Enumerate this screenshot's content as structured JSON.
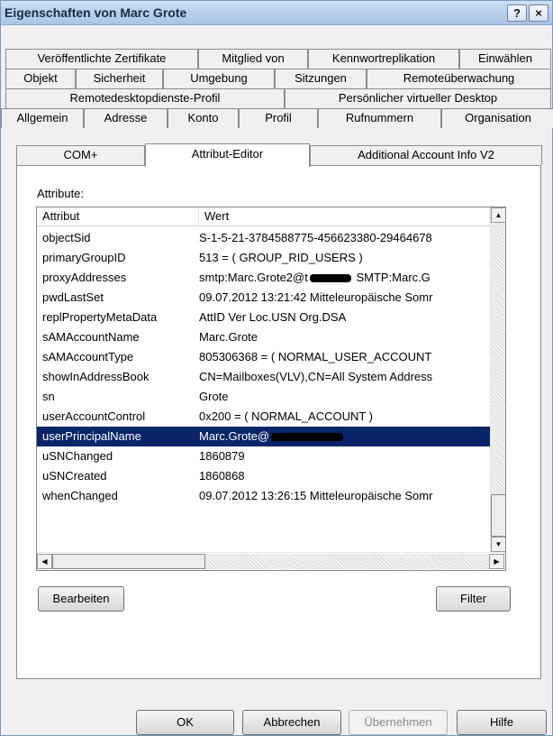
{
  "window": {
    "title": "Eigenschaften von Marc Grote",
    "help_label": "?",
    "close_label": "×"
  },
  "tabs": {
    "row1": [
      "Veröffentlichte Zertifikate",
      "Mitglied von",
      "Kennwortreplikation",
      "Einwählen"
    ],
    "row2": [
      "Objekt",
      "Sicherheit",
      "Umgebung",
      "Sitzungen",
      "Remoteüberwachung"
    ],
    "row3": [
      "Remotedesktopdienste-Profil",
      "Persönlicher virtueller Desktop"
    ],
    "row4": [
      "Allgemein",
      "Adresse",
      "Konto",
      "Profil",
      "Rufnummern",
      "Organisation"
    ],
    "row5": [
      "COM+",
      "Attribut-Editor",
      "Additional Account Info V2"
    ],
    "active": "Attribut-Editor"
  },
  "attributes": {
    "label": "Attribute:",
    "columns": [
      "Attribut",
      "Wert"
    ],
    "rows": [
      {
        "name": "objectSid",
        "value": "S-1-5-21-3784588775-456623380-29464678"
      },
      {
        "name": "primaryGroupID",
        "value": "513 = ( GROUP_RID_USERS )"
      },
      {
        "name": "proxyAddresses",
        "value_pre": "smtp:Marc.Grote2@t",
        "value_post": " SMTP:Marc.G",
        "redacted": true
      },
      {
        "name": "pwdLastSet",
        "value": "09.07.2012 13:21:42 Mitteleuropäische Somr"
      },
      {
        "name": "replPropertyMetaData",
        "value": "AttID  Ver   Loc.USN              Org.DSA"
      },
      {
        "name": "sAMAccountName",
        "value": "Marc.Grote"
      },
      {
        "name": "sAMAccountType",
        "value": "805306368 = ( NORMAL_USER_ACCOUNT"
      },
      {
        "name": "showInAddressBook",
        "value": "CN=Mailboxes(VLV),CN=All System Address"
      },
      {
        "name": "sn",
        "value": "Grote"
      },
      {
        "name": "userAccountControl",
        "value": "0x200 = ( NORMAL_ACCOUNT )"
      },
      {
        "name": "userPrincipalName",
        "value_pre": "Marc.Grote@",
        "value_post": "",
        "redacted": true,
        "selected": true
      },
      {
        "name": "uSNChanged",
        "value": "1860879"
      },
      {
        "name": "uSNCreated",
        "value": "1860868"
      },
      {
        "name": "whenChanged",
        "value": "09.07.2012 13:26:15 Mitteleuropäische Somr"
      }
    ],
    "selected_row": "userPrincipalName"
  },
  "panel_buttons": {
    "edit_label": "Bearbeiten",
    "filter_label": "Filter"
  },
  "dialog_buttons": {
    "ok_label": "OK",
    "cancel_label": "Abbrechen",
    "apply_label": "Übernehmen",
    "help_label": "Hilfe"
  },
  "colors": {
    "selection": "#0a246a",
    "titlebar": "#b9d1ee"
  }
}
